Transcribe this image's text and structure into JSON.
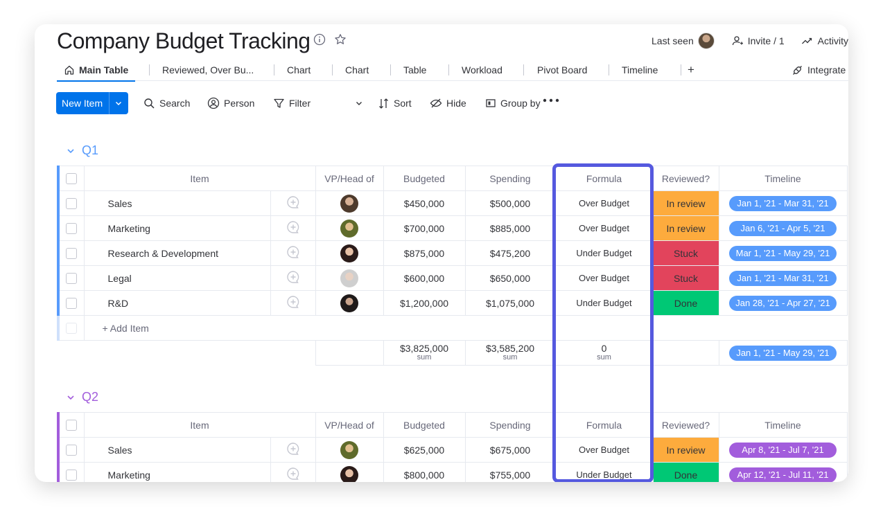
{
  "board": {
    "title": "Company Budget Tracking",
    "last_seen_label": "Last seen",
    "invite_label": "Invite / 1",
    "activity_label": "Activity"
  },
  "tabs": [
    {
      "label": "Main Table"
    },
    {
      "label": "Reviewed, Over Bu..."
    },
    {
      "label": "Chart"
    },
    {
      "label": "Chart"
    },
    {
      "label": "Table"
    },
    {
      "label": "Workload"
    },
    {
      "label": "Pivot Board"
    },
    {
      "label": "Timeline"
    },
    {
      "label": "+"
    }
  ],
  "integrate_label": "Integrate",
  "toolbar": {
    "new_item": "New Item",
    "search": "Search",
    "person": "Person",
    "filter": "Filter",
    "sort": "Sort",
    "hide": "Hide",
    "group_by": "Group by"
  },
  "columns": [
    "Item",
    "VP/Head of",
    "Budgeted",
    "Spending",
    "Formula",
    "Reviewed?",
    "Timeline"
  ],
  "colors": {
    "q1": "#579bfc",
    "q2": "#a25ddc",
    "in_review": "#fdab3d",
    "stuck": "#e2445c",
    "done": "#00c875",
    "highlight": "#5559df",
    "primary": "#0073ea"
  },
  "groups": [
    {
      "name": "Q1",
      "rows": [
        {
          "item": "Sales",
          "budgeted": "$450,000",
          "spending": "$500,000",
          "formula": "Over Budget",
          "reviewed": "In review",
          "timeline": "Jan 1, '21 - Mar 31, '21"
        },
        {
          "item": "Marketing",
          "budgeted": "$700,000",
          "spending": "$885,000",
          "formula": "Over Budget",
          "reviewed": "In review",
          "timeline": "Jan 6, '21 - Apr 5, '21"
        },
        {
          "item": "Research & Development",
          "budgeted": "$875,000",
          "spending": "$475,200",
          "formula": "Under Budget",
          "reviewed": "Stuck",
          "timeline": "Mar 1, '21 - May 29, '21"
        },
        {
          "item": "Legal",
          "budgeted": "$600,000",
          "spending": "$650,000",
          "formula": "Over Budget",
          "reviewed": "Stuck",
          "timeline": "Jan 1, '21 - Mar 31, '21"
        },
        {
          "item": "R&D",
          "budgeted": "$1,200,000",
          "spending": "$1,075,000",
          "formula": "Under Budget",
          "reviewed": "Done",
          "timeline": "Jan 28, '21 - Apr 27, '21"
        }
      ],
      "add_item": "+ Add Item",
      "summary": {
        "budgeted": "$3,825,000",
        "spending": "$3,585,200",
        "formula": "0",
        "sum_label": "sum",
        "timeline": "Jan 1, '21 - May 29, '21"
      }
    },
    {
      "name": "Q2",
      "rows": [
        {
          "item": "Sales",
          "budgeted": "$625,000",
          "spending": "$675,000",
          "formula": "Over Budget",
          "reviewed": "In review",
          "timeline": "Apr 8, '21 - Jul 7, '21"
        },
        {
          "item": "Marketing",
          "budgeted": "$800,000",
          "spending": "$755,000",
          "formula": "Under Budget",
          "reviewed": "Done",
          "timeline": "Apr 12, '21 - Jul 11, '21"
        }
      ]
    }
  ]
}
